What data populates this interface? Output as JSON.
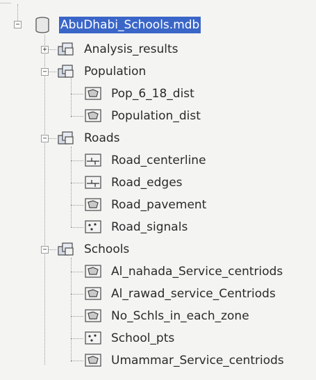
{
  "tree": {
    "root": {
      "label": "AbuDhabi_Schools.mdb",
      "icon": "database-icon",
      "expanded": true,
      "selected": true
    },
    "nodes": [
      {
        "id": "analysis-results",
        "label": "Analysis_results",
        "icon": "feature-dataset-icon",
        "toggle": "+",
        "level": 1
      },
      {
        "id": "population",
        "label": "Population",
        "icon": "feature-dataset-icon",
        "toggle": "−",
        "level": 1
      },
      {
        "id": "pop-6-18-dist",
        "label": "Pop_6_18_dist",
        "icon": "polygon-feature-class-icon",
        "level": 2
      },
      {
        "id": "population-dist",
        "label": "Population_dist",
        "icon": "polygon-feature-class-icon",
        "level": 2
      },
      {
        "id": "roads",
        "label": "Roads",
        "icon": "feature-dataset-icon",
        "toggle": "−",
        "level": 1
      },
      {
        "id": "road-centerline",
        "label": "Road_centerline",
        "icon": "line-feature-class-icon",
        "level": 2
      },
      {
        "id": "road-edges",
        "label": "Road_edges",
        "icon": "line-feature-class-icon",
        "level": 2
      },
      {
        "id": "road-pavement",
        "label": "Road_pavement",
        "icon": "polygon-feature-class-icon",
        "level": 2
      },
      {
        "id": "road-signals",
        "label": "Road_signals",
        "icon": "point-feature-class-icon",
        "level": 2
      },
      {
        "id": "schools",
        "label": "Schools",
        "icon": "feature-dataset-icon",
        "toggle": "−",
        "level": 1
      },
      {
        "id": "al-nahada",
        "label": "Al_nahada_Service_centriods",
        "icon": "polygon-feature-class-icon",
        "level": 2
      },
      {
        "id": "al-rawad",
        "label": "Al_rawad_service_Centriods",
        "icon": "polygon-feature-class-icon",
        "level": 2
      },
      {
        "id": "no-schls",
        "label": "No_Schls_in_each_zone",
        "icon": "polygon-feature-class-icon",
        "level": 2
      },
      {
        "id": "school-pts",
        "label": "School_pts",
        "icon": "point-feature-class-icon",
        "level": 2
      },
      {
        "id": "umammar",
        "label": "Umammar_Service_centriods",
        "icon": "polygon-feature-class-icon",
        "level": 2
      }
    ]
  },
  "colors": {
    "selection": "#3a66c8",
    "tree_lines": "#9a9a9a",
    "background": "#f4f4f2",
    "icon_fill": "#d4dbe8"
  }
}
